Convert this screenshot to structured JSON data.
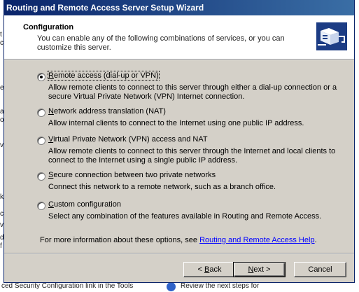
{
  "window": {
    "title": "Routing and Remote Access Server Setup Wizard"
  },
  "header": {
    "title": "Configuration",
    "subtitle": "You can enable any of the following combinations of services, or you can customize this server."
  },
  "options": [
    {
      "label_pre": "",
      "label_key": "R",
      "label_post": "emote access (dial-up or VPN)",
      "description": "Allow remote clients to connect to this server through either a dial-up connection or a secure Virtual Private Network (VPN) Internet connection.",
      "selected": true
    },
    {
      "label_pre": "",
      "label_key": "N",
      "label_post": "etwork address translation (NAT)",
      "description": "Allow internal clients to connect to the Internet using one public IP address.",
      "selected": false
    },
    {
      "label_pre": "",
      "label_key": "V",
      "label_post": "irtual Private Network (VPN) access and NAT",
      "description": "Allow remote clients to connect to this server through the Internet and local clients to connect to the Internet using a single public IP address.",
      "selected": false
    },
    {
      "label_pre": "",
      "label_key": "S",
      "label_post": "ecure connection between two private networks",
      "description": "Connect this network to a remote network, such as a branch office.",
      "selected": false
    },
    {
      "label_pre": "",
      "label_key": "C",
      "label_post": "ustom configuration",
      "description": "Select any combination of the features available in Routing and Remote Access.",
      "selected": false
    }
  ],
  "more_info": {
    "text": "For more information about these options, see ",
    "link": "Routing and Remote Access Help",
    "suffix": "."
  },
  "buttons": {
    "back_pre": "< ",
    "back_key": "B",
    "back_post": "ack",
    "next_pre": "",
    "next_key": "N",
    "next_post": "ext >",
    "cancel": "Cancel"
  },
  "background": {
    "left_fragments": [
      "t",
      "c",
      "e",
      "a",
      "o",
      "v",
      "k",
      "c",
      "v",
      "d",
      "f"
    ],
    "bottom_left": "ced Security Configuration link in the Tools",
    "bottom_right": "Review the next steps for"
  },
  "colors": {
    "titlebar_start": "#0a246a",
    "titlebar_end": "#3a6ea5",
    "dialog_bg": "#d4d0c8",
    "link": "#0000ff"
  }
}
